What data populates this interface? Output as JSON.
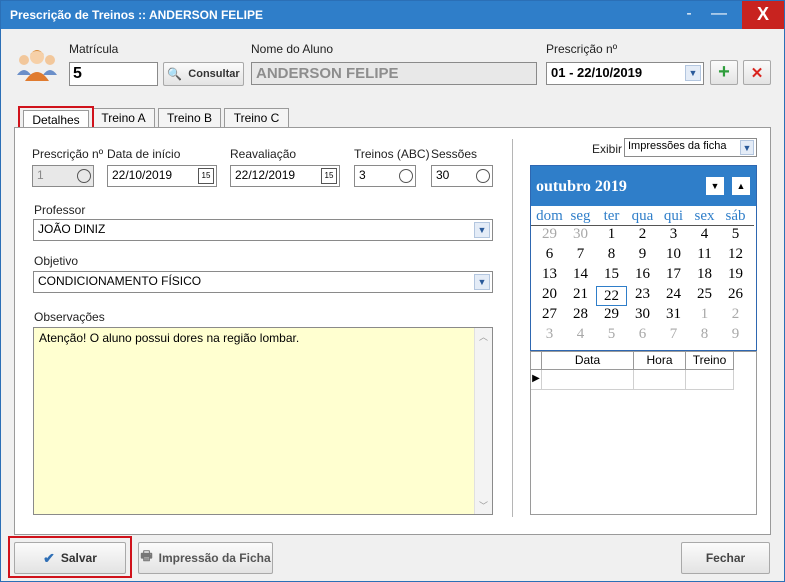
{
  "window": {
    "title": "Prescrição de Treinos  ::  ANDERSON FELIPE",
    "minimize_glyph": "-",
    "restore_glyph": "—",
    "close_glyph": "X"
  },
  "header": {
    "matricula_label": "Matrícula",
    "matricula_value": "5",
    "consultar_label": "Consultar",
    "nome_label": "Nome do Aluno",
    "nome_value": "ANDERSON FELIPE",
    "prescricao_label": "Prescrição nº",
    "prescricao_value": "01 - 22/10/2019",
    "add_glyph": "+",
    "delete_glyph": "✕"
  },
  "tabs": [
    {
      "label": "Detalhes"
    },
    {
      "label": "Treino A"
    },
    {
      "label": "Treino B"
    },
    {
      "label": "Treino C"
    }
  ],
  "form": {
    "prescricao_label": "Prescrição nº",
    "prescricao_value": "1",
    "inicio_label": "Data de início",
    "inicio_value": "22/10/2019",
    "reavaliacao_label": "Reavaliação",
    "reavaliacao_value": "22/12/2019",
    "treinos_label": "Treinos (ABC)",
    "treinos_value": "3",
    "sessoes_label": "Sessões",
    "sessoes_value": "30",
    "professor_label": "Professor",
    "professor_value": "JOÃO DINIZ",
    "objetivo_label": "Objetivo",
    "objetivo_value": "CONDICIONAMENTO FÍSICO",
    "observacoes_label": "Observações",
    "observacoes_value": "Atenção! O aluno possui dores na região lombar."
  },
  "side": {
    "exibir_label": "Exibir",
    "exibir_value": "Impressões da ficha",
    "calendar": {
      "month_label": "outubro 2019",
      "dow": [
        "dom",
        "seg",
        "ter",
        "qua",
        "qui",
        "sex",
        "sáb"
      ],
      "days": [
        {
          "d": "29",
          "m": true
        },
        {
          "d": "30",
          "m": true
        },
        {
          "d": "1"
        },
        {
          "d": "2"
        },
        {
          "d": "3"
        },
        {
          "d": "4"
        },
        {
          "d": "5"
        },
        {
          "d": "6"
        },
        {
          "d": "7"
        },
        {
          "d": "8"
        },
        {
          "d": "9"
        },
        {
          "d": "10"
        },
        {
          "d": "11"
        },
        {
          "d": "12"
        },
        {
          "d": "13"
        },
        {
          "d": "14"
        },
        {
          "d": "15"
        },
        {
          "d": "16"
        },
        {
          "d": "17"
        },
        {
          "d": "18"
        },
        {
          "d": "19"
        },
        {
          "d": "20"
        },
        {
          "d": "21"
        },
        {
          "d": "22",
          "t": true
        },
        {
          "d": "23"
        },
        {
          "d": "24"
        },
        {
          "d": "25"
        },
        {
          "d": "26"
        },
        {
          "d": "27"
        },
        {
          "d": "28"
        },
        {
          "d": "29"
        },
        {
          "d": "30"
        },
        {
          "d": "31"
        },
        {
          "d": "1",
          "m": true
        },
        {
          "d": "2",
          "m": true
        },
        {
          "d": "3",
          "m": true
        },
        {
          "d": "4",
          "m": true
        },
        {
          "d": "5",
          "m": true
        },
        {
          "d": "6",
          "m": true
        },
        {
          "d": "7",
          "m": true
        },
        {
          "d": "8",
          "m": true
        },
        {
          "d": "9",
          "m": true
        }
      ]
    },
    "table": {
      "columns": [
        "Data",
        "Hora",
        "Treino"
      ]
    }
  },
  "footer": {
    "salvar_label": "Salvar",
    "impressao_label": "Impressão da Ficha",
    "fechar_label": "Fechar"
  }
}
